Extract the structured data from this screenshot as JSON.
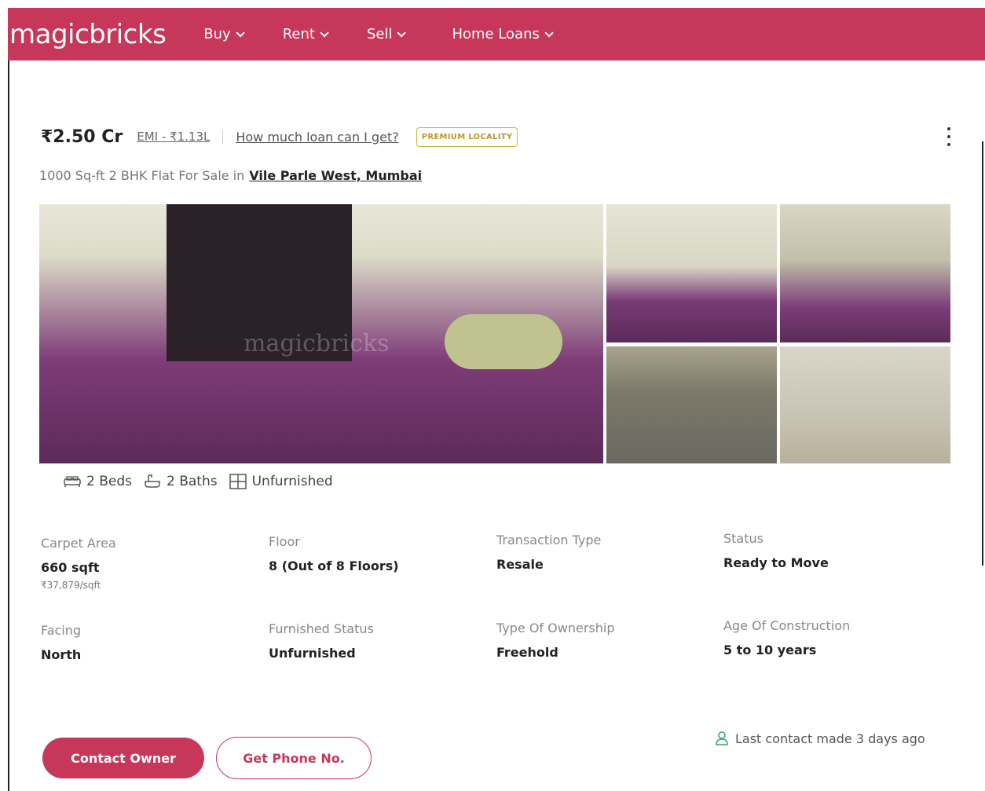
{
  "header": {
    "logo": "magicbricks",
    "nav": [
      {
        "label": "Buy"
      },
      {
        "label": "Rent"
      },
      {
        "label": "Sell"
      },
      {
        "label": "Home Loans"
      }
    ]
  },
  "listing": {
    "price": "₹2.50 Cr",
    "emi": "EMI - ₹1.13L",
    "loan_link": "How much loan can I get?",
    "badge": "PREMIUM LOCALITY",
    "subtitle": "1000 Sq-ft 2 BHK Flat For Sale in",
    "location": "Vile Parle West, Mumbai",
    "watermark": "magicbricks"
  },
  "specs": {
    "beds": "2 Beds",
    "baths": "2 Baths",
    "furnishing": "Unfurnished"
  },
  "details": {
    "carpet_area": {
      "label": "Carpet Area",
      "value": "660 sqft",
      "sub": "₹37,879/sqft"
    },
    "floor": {
      "label": "Floor",
      "value": "8 (Out of 8 Floors)"
    },
    "transaction_type": {
      "label": "Transaction Type",
      "value": "Resale"
    },
    "status": {
      "label": "Status",
      "value": "Ready to Move"
    },
    "facing": {
      "label": "Facing",
      "value": "North"
    },
    "furnished_status": {
      "label": "Furnished Status",
      "value": "Unfurnished"
    },
    "ownership": {
      "label": "Type Of Ownership",
      "value": "Freehold"
    },
    "age": {
      "label": "Age Of Construction",
      "value": "5 to 10 years"
    }
  },
  "actions": {
    "contact_owner": "Contact Owner",
    "get_phone": "Get Phone No.",
    "last_contact": "Last contact made 3 days ago"
  },
  "colors": {
    "brand": "#c6375a",
    "badge": "#b89a2a"
  }
}
